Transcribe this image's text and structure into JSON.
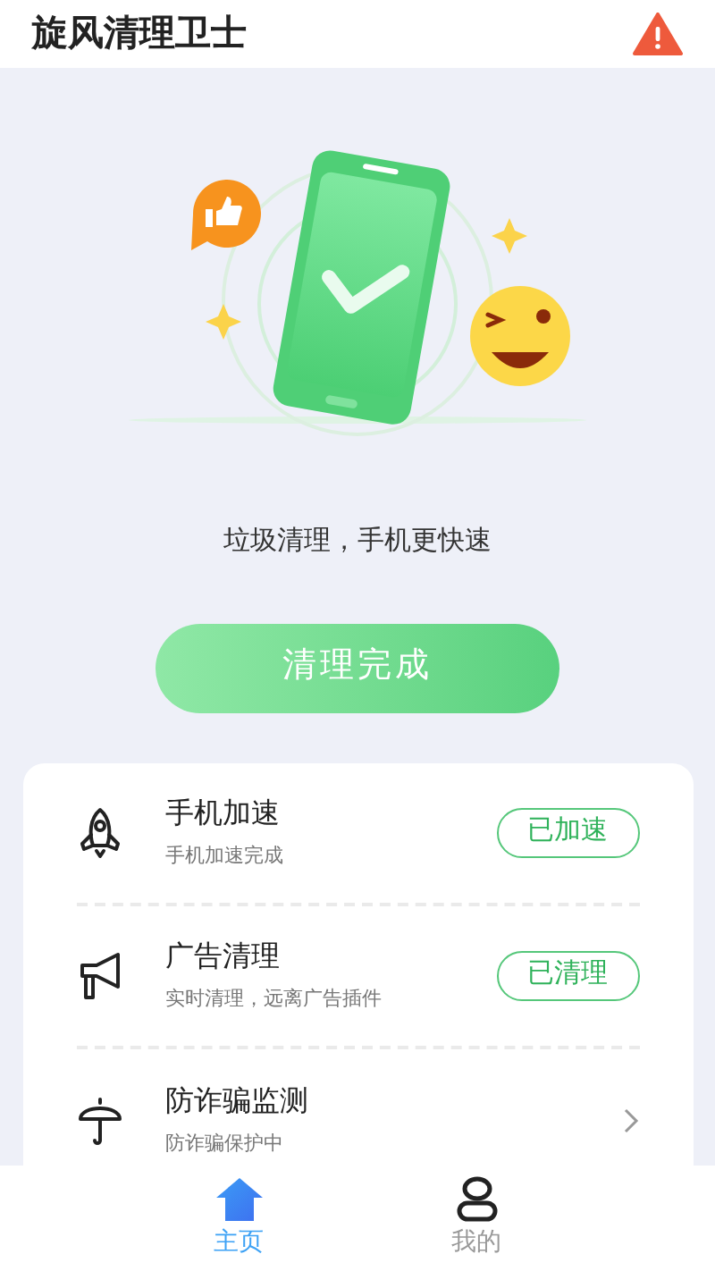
{
  "header": {
    "title": "旋风清理卫士"
  },
  "tagline": "垃圾清理，手机更快速",
  "main_button": "清理完成",
  "features": [
    {
      "kind": "button",
      "title": "手机加速",
      "subtitle": "手机加速完成",
      "action": "已加速"
    },
    {
      "kind": "button",
      "title": "广告清理",
      "subtitle": "实时清理，远离广告插件",
      "action": "已清理"
    },
    {
      "kind": "link",
      "title": "防诈骗监测",
      "subtitle": "防诈骗保护中"
    }
  ],
  "tabs": [
    {
      "label": "主页",
      "selected": true
    },
    {
      "label": "我的",
      "selected": false
    }
  ]
}
